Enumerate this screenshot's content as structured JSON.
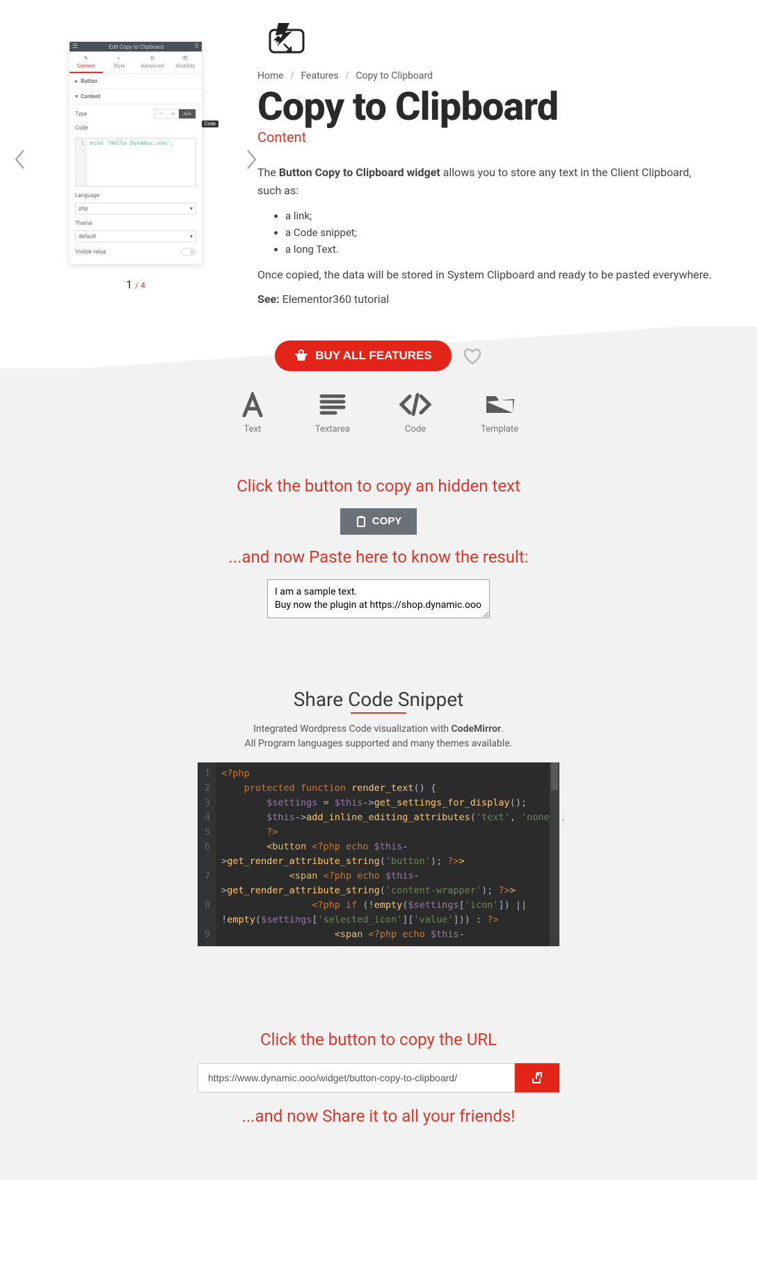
{
  "breadcrumb": {
    "home": "Home",
    "features": "Features",
    "current": "Copy to Clipboard"
  },
  "page": {
    "title": "Copy to Clipboard",
    "subtitle": "Content",
    "intro_prefix": "The ",
    "intro_bold": "Button Copy to Clipboard widget",
    "intro_suffix": " allows you to store any text in the Client Clipboard, such as:",
    "bullets": {
      "b1": "a link;",
      "b2": "a Code snippet;",
      "b3": "a long Text."
    },
    "outro": "Once copied, the data will be stored in System Clipboard and ready to be pasted everywhere.",
    "see_label": "See: ",
    "see_link": "Elementor360 tutorial"
  },
  "buy": {
    "label": "BUY ALL FEATURES"
  },
  "icons": {
    "text": "Text",
    "textarea": "Textarea",
    "code": "Code",
    "template": "Template"
  },
  "copy_demo": {
    "heading": "Click the button to copy an hidden text",
    "button": "COPY",
    "paste_heading": "...and now Paste here to know the result:",
    "textarea": "I am a sample text.\nBuy now the plugin at https://shop.dynamic.ooo"
  },
  "snippet": {
    "title": "Share Code Snippet",
    "sub_prefix": "Integrated Wordpress Code visualization with ",
    "sub_bold": "CodeMirror",
    "sub_suffix": ".",
    "sub_line2": "All Program languages supported and many themes available."
  },
  "url_demo": {
    "heading": "Click the button to copy the URL",
    "value": "https://www.dynamic.ooo/widget/button-copy-to-clipboard/",
    "share_heading": "...and now Share it to all your friends!"
  },
  "carousel": {
    "title": "Edit Copy to Clipboard",
    "tabs": {
      "content": "Content",
      "style": "Style",
      "advanced": "Advanced",
      "visibility": "Visibility"
    },
    "section_button": "Button",
    "section_content": "Content",
    "labels": {
      "type": "Type",
      "code": "Code",
      "language": "Language",
      "theme": "Theme",
      "visible": "Visible value"
    },
    "tooltip": "Code",
    "code_line": "echo 'Hello Dynamic.ooo';",
    "lang_value": "php",
    "theme_value": "default",
    "pager_current": "1",
    "pager_total": "/ 4"
  }
}
